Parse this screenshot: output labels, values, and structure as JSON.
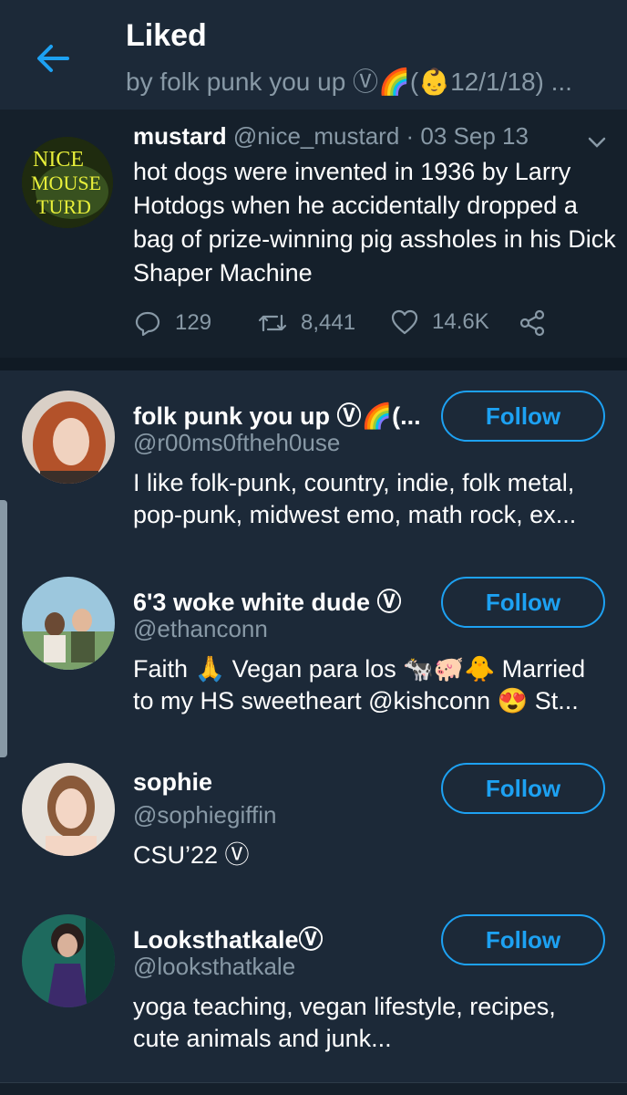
{
  "header": {
    "title": "Liked",
    "subtitle": "by folk punk you up Ⓥ🌈(👶12/1/18) ..."
  },
  "tweet": {
    "name": "mustard",
    "handle": "@nice_mustard",
    "date": "· 03 Sep 13",
    "avatar_text": "NICE MOUSE TURD",
    "text": "hot dogs were invented in 1936 by Larry Hotdogs when he accidentally dropped a bag of prize-winning pig assholes in his Dick Shaper Machine",
    "replies": "129",
    "retweets": "8,441",
    "likes": "14.6K"
  },
  "users": [
    {
      "name": "folk punk you up Ⓥ🌈(...",
      "handle": "@r00ms0ftheh0use",
      "bio": "I like folk-punk, country, indie, folk metal, pop-punk, midwest emo, math rock, ex...",
      "follow_label": "Follow"
    },
    {
      "name": "6'3 woke white dude Ⓥ",
      "handle": "@ethanconn",
      "bio": "Faith 🙏 Vegan para los 🐄🐖🐥 Married to my HS sweetheart @kishconn 😍 St...",
      "follow_label": "Follow"
    },
    {
      "name": "sophie",
      "handle": "@sophiegiffin",
      "bio": "CSU’22 Ⓥ",
      "follow_label": "Follow"
    },
    {
      "name": "LooksthatkaleⓋ",
      "handle": "@looksthatkale",
      "bio": "yoga teaching, vegan lifestyle, recipes, cute animals and junk...",
      "follow_label": "Follow"
    }
  ],
  "colors": {
    "background": "#15202b",
    "card": "#1c2938",
    "accent": "#1da1f2",
    "muted": "#8899a6"
  }
}
